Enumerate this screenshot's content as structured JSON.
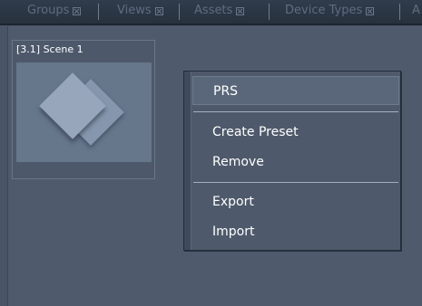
{
  "tabs": [
    {
      "label": "Groups"
    },
    {
      "label": "Views"
    },
    {
      "label": "Assets"
    },
    {
      "label": "Device Types"
    },
    {
      "label": "A"
    }
  ],
  "scene": {
    "title": "[3.1] Scene 1"
  },
  "context_menu": {
    "items": [
      {
        "label": "PRS"
      },
      {
        "label": "Create Preset"
      },
      {
        "label": "Remove"
      },
      {
        "label": "Export"
      },
      {
        "label": "Import"
      }
    ]
  }
}
